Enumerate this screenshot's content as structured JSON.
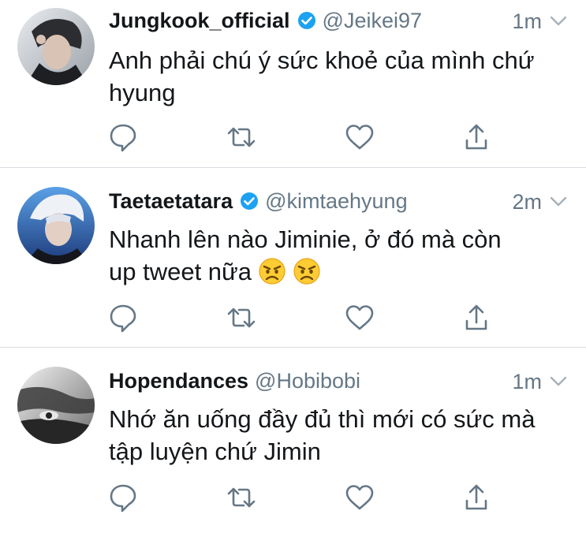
{
  "tweets": [
    {
      "name": "Jungkook_official",
      "handle": "@Jeikei97",
      "verified": true,
      "time": "1m",
      "line1": "Anh phải chú ý sức khoẻ của mình chứ",
      "line2": "hyung",
      "emoji_count": 0
    },
    {
      "name": "Taetaetatara",
      "handle": "@kimtaehyung",
      "verified": true,
      "time": "2m",
      "line1": "Nhanh lên nào Jiminie, ở đó mà còn",
      "line2": "up tweet nữa",
      "emoji": "😠",
      "emoji_count": 2
    },
    {
      "name": "Hopendances",
      "handle": "@Hobibobi",
      "verified": false,
      "time": "1m",
      "line1": "Nhớ ăn uống đầy đủ thì mới có sức mà",
      "line2": "tập luyện chứ Jimin",
      "emoji_count": 0
    }
  ],
  "icons": {
    "reply": "reply-icon",
    "retweet": "retweet-icon",
    "like": "heart-icon",
    "share": "share-icon",
    "verified": "verified-badge-icon",
    "more": "chevron-down-icon"
  },
  "colors": {
    "icon_gray": "#657786",
    "verified_blue": "#1da1f2",
    "divider": "#d6dce1",
    "text": "#14171a"
  }
}
